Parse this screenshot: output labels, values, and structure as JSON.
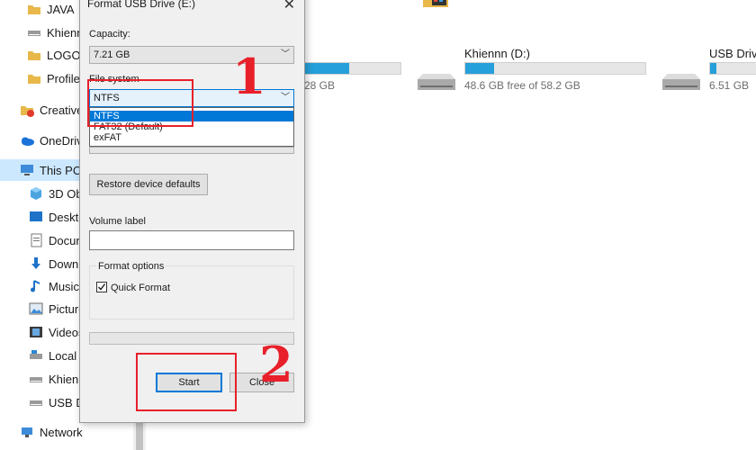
{
  "nav": {
    "items": [
      {
        "label": "JAVA",
        "icon": "folder-icon"
      },
      {
        "label": "Khienn",
        "icon": "drive-icon"
      },
      {
        "label": "LOGO",
        "icon": "folder-icon"
      },
      {
        "label": "Profile",
        "icon": "folder-icon"
      },
      {
        "label": "Creative",
        "icon": "creative-cloud-icon"
      },
      {
        "label": "OneDriv",
        "icon": "onedrive-icon"
      },
      {
        "label": "This PC",
        "icon": "computer-icon"
      },
      {
        "label": "3D Ob",
        "icon": "3d-objects-icon"
      },
      {
        "label": "Deskto",
        "icon": "desktop-icon"
      },
      {
        "label": "Docun",
        "icon": "documents-icon"
      },
      {
        "label": "Downl",
        "icon": "downloads-icon"
      },
      {
        "label": "Music",
        "icon": "music-icon"
      },
      {
        "label": "Picture",
        "icon": "pictures-icon"
      },
      {
        "label": "Videos",
        "icon": "videos-icon"
      },
      {
        "label": "Local D",
        "icon": "drive-icon"
      },
      {
        "label": "Khienn",
        "icon": "drive-icon"
      },
      {
        "label": "USB D",
        "icon": "usb-drive-icon"
      },
      {
        "label": "Network",
        "icon": "network-icon"
      }
    ]
  },
  "drives": [
    {
      "name": "",
      "free": "28 GB",
      "usage": 0.5
    },
    {
      "name": "Khiennn (D:)",
      "free": "48.6 GB free of 58.2 GB",
      "usage": 0.16
    },
    {
      "name": "USB Drive",
      "free": "6.51 GB",
      "usage": 0.1
    }
  ],
  "dialog": {
    "title": "Format USB Drive (E:)",
    "close_glyph": "✕",
    "capacity_label": "Capacity:",
    "capacity_value": "7.21 GB",
    "filesystem_label": "File system",
    "filesystem_value": "NTFS",
    "filesystem_options": [
      "NTFS",
      "FAT32 (Default)",
      "exFAT"
    ],
    "restore_button": "Restore device defaults",
    "volume_label": "Volume label",
    "volume_value": "",
    "format_options_label": "Format options",
    "quick_format_label": "Quick Format",
    "quick_format_checked": true,
    "start_button": "Start",
    "close_button": "Close"
  },
  "annotations": {
    "step1": "1",
    "step2": "2",
    "accent": "#e8202a"
  }
}
